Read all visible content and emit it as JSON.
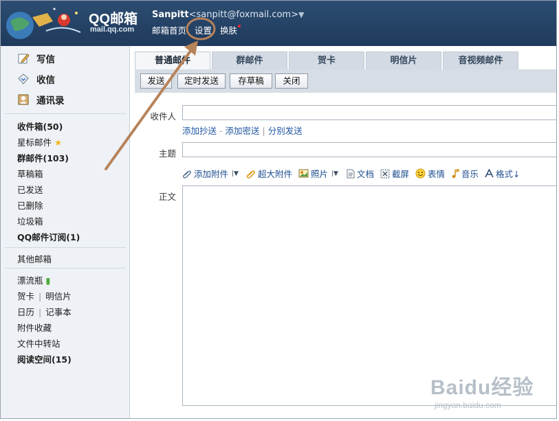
{
  "header": {
    "logo_title": "QQ邮箱",
    "logo_sub": "mail.qq.com",
    "account_name": "Sanpitt",
    "account_email": "<sanpitt@foxmail.com>",
    "nav": [
      "邮箱首页",
      "设置",
      "换肤"
    ]
  },
  "sidebar": {
    "compose": [
      "写信",
      "收信",
      "通讯录"
    ],
    "folders_main": [
      "收件箱(50)",
      "星标邮件",
      "群邮件(103)",
      "草稿箱",
      "已发送",
      "已删除",
      "垃圾箱",
      "QQ邮件订阅(1)"
    ],
    "other_mailboxes": "其他邮箱",
    "tools": {
      "drift_bottle": "漂流瓶",
      "card": "贺卡",
      "postcard": "明信片",
      "calendar": "日历",
      "notebook": "记事本",
      "attach_collect": "附件收藏",
      "file_transfer": "文件中转站",
      "reading_space": "阅读空间(15)"
    }
  },
  "tabs": [
    "普通邮件",
    "群邮件",
    "贺卡",
    "明信片",
    "音视频邮件"
  ],
  "toolbar": {
    "send": "发送",
    "timed_send": "定时发送",
    "save_draft": "存草稿",
    "close": "关闭"
  },
  "form": {
    "to_label": "收件人",
    "add_cc": "添加抄送",
    "add_bcc": "添加密送",
    "separate_send": "分别发送",
    "subject_label": "主题",
    "body_label": "正文",
    "attach_tools": [
      "添加附件",
      "超大附件",
      "照片",
      "文档",
      "截屏",
      "表情",
      "音乐",
      "格式↓"
    ]
  },
  "watermark": {
    "brand": "Baidu经验",
    "url": "jingyan.baidu.com"
  },
  "colors": {
    "header_bg": "#2c4d72",
    "sidebar_bg": "#eef2f6",
    "link": "#1f56a3",
    "annotation_arrow": "#b7835a"
  }
}
